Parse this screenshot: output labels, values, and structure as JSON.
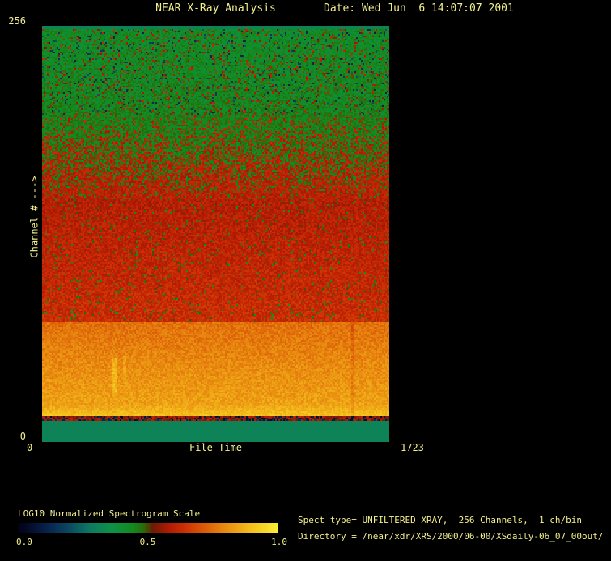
{
  "window": {
    "background": "#000000",
    "text_color": "#f2ef8d"
  },
  "header": {
    "title": "NEAR X-Ray Analysis",
    "date_label": "Date: Wed Jun  6 14:07:07 2001"
  },
  "axes": {
    "y_max_label": "256",
    "y_min_label": "0",
    "y_axis_label": "Channel # --->",
    "x_min_label": "0",
    "x_axis_label": "File Time",
    "x_max_label": "1723"
  },
  "colorbar": {
    "label": "LOG10 Normalized Spectrogram Scale",
    "tick_labels": [
      "0.0",
      "0.5",
      "1.0"
    ]
  },
  "info": {
    "line1": "Spect type= UNFILTERED XRAY,  256 Channels,  1 ch/bin",
    "line2": "Directory = /near/xdr/XRS/2000/06-00/XSdaily-06_07_00out/"
  },
  "chart_data": {
    "type": "heatmap",
    "title": "NEAR X-Ray Analysis",
    "xlabel": "File Time",
    "ylabel": "Channel #",
    "xlim": [
      0,
      1723
    ],
    "ylim": [
      0,
      256
    ],
    "bins_per_channel": "1 ch/bin",
    "colorbar_label": "LOG10 Normalized Spectrogram Scale",
    "colorbar_range": [
      0.0,
      1.0
    ],
    "colormap_stops": [
      [
        0.0,
        "#010112"
      ],
      [
        0.06,
        "#041034"
      ],
      [
        0.13,
        "#082952"
      ],
      [
        0.2,
        "#0b4a60"
      ],
      [
        0.28,
        "#0d7a62"
      ],
      [
        0.36,
        "#0f9148"
      ],
      [
        0.44,
        "#118c20"
      ],
      [
        0.485,
        "#2a6a08"
      ],
      [
        0.52,
        "#6d1a04"
      ],
      [
        0.58,
        "#b01a04"
      ],
      [
        0.64,
        "#cc2e04"
      ],
      [
        0.72,
        "#dc5c08"
      ],
      [
        0.8,
        "#e98c10"
      ],
      [
        0.9,
        "#f4c01c"
      ],
      [
        1.0,
        "#fcee34"
      ]
    ],
    "bands": [
      {
        "name": "bottom-solid-teal",
        "ch": [
          0,
          13
        ],
        "value": [
          0.31,
          0.31
        ],
        "noise": 0.0
      },
      {
        "name": "dark-noisy-strip",
        "ch": [
          13,
          16
        ],
        "value": [
          0.56,
          0.56
        ],
        "noise": 0.05,
        "dark_speck_prob": 0.28,
        "dark_value": 0.03
      },
      {
        "name": "bright-yellow-base",
        "ch": [
          16,
          23
        ],
        "value": [
          0.9,
          0.84
        ],
        "noise": 0.035
      },
      {
        "name": "orange-region",
        "ch": [
          23,
          74
        ],
        "value": [
          0.84,
          0.75
        ],
        "noise": 0.042
      },
      {
        "name": "red-region",
        "ch": [
          74,
          150
        ],
        "value": [
          0.635,
          0.59
        ],
        "noise": 0.04,
        "speck_prob": 0.05,
        "speck_value": 0.46
      },
      {
        "name": "red-green-mix",
        "ch": [
          150,
          202
        ],
        "bimodal": {
          "high": 0.6,
          "low": 0.45,
          "low_prob": [
            0.1,
            0.9
          ]
        },
        "noise": 0.035
      },
      {
        "name": "green-top",
        "ch": [
          202,
          255
        ],
        "value": [
          0.445,
          0.425
        ],
        "noise": 0.045,
        "speck_prob": 0.09,
        "speck_value": 0.585,
        "dark_speck_prob": 0.05,
        "dark_value": 0.1
      },
      {
        "name": "top-solid-teal",
        "ch": [
          255,
          258
        ],
        "value": [
          0.31,
          0.31
        ],
        "noise": 0.0
      }
    ],
    "streaks": [
      {
        "x_frac": 0.2,
        "ch": [
          30,
          52
        ],
        "delta": 0.07,
        "width": 3
      },
      {
        "x_frac": 0.231,
        "ch": [
          36,
          54
        ],
        "delta": 0.045,
        "width": 2
      },
      {
        "x_frac": 0.886,
        "ch": [
          14,
          74
        ],
        "delta": -0.042,
        "width": 2
      }
    ],
    "grid": false,
    "legend_position": "none"
  }
}
